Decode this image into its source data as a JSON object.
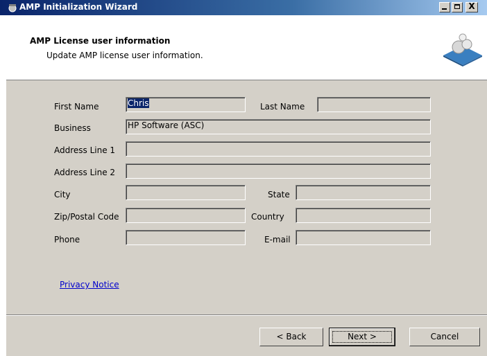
{
  "window": {
    "title": "AMP Initialization Wizard",
    "controls": {
      "minimize": "_",
      "maximize": "□",
      "close": "X"
    }
  },
  "header": {
    "title": "AMP License user information",
    "subtitle": "Update AMP license user information.",
    "logo_icon": "amp-wizard-logo-icon"
  },
  "form": {
    "first_name": {
      "label": "First Name",
      "value": "Chris"
    },
    "last_name": {
      "label": "Last Name",
      "value": ""
    },
    "business": {
      "label": "Business",
      "value": "HP Software (ASC)"
    },
    "address1": {
      "label": "Address Line 1",
      "value": ""
    },
    "address2": {
      "label": "Address Line 2",
      "value": ""
    },
    "city": {
      "label": "City",
      "value": ""
    },
    "state": {
      "label": "State",
      "value": ""
    },
    "zip": {
      "label": "Zip/Postal Code",
      "value": ""
    },
    "country": {
      "label": "Country",
      "value": ""
    },
    "phone": {
      "label": "Phone",
      "value": ""
    },
    "email": {
      "label": "E-mail",
      "value": ""
    }
  },
  "links": {
    "privacy": "Privacy Notice"
  },
  "buttons": {
    "back": "< Back",
    "next": "Next >",
    "cancel": "Cancel"
  },
  "colors": {
    "titlebar": "#0a246a",
    "face": "#d4d0c8",
    "link": "#0000cc",
    "selection": "#0a246a"
  }
}
